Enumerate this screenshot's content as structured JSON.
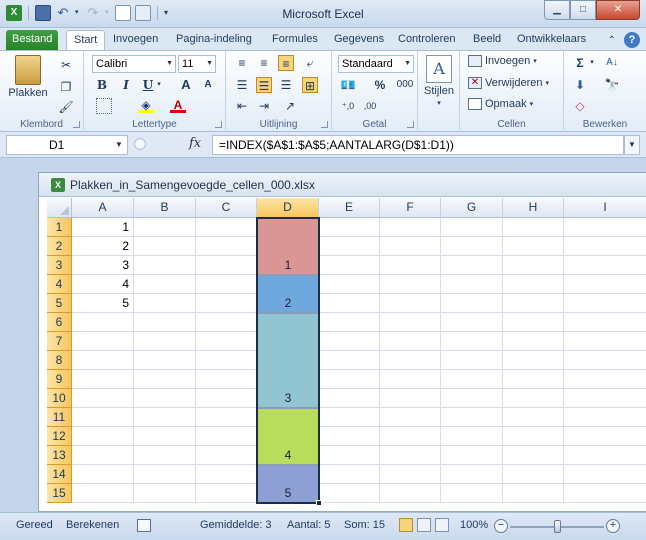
{
  "app": {
    "title": "Microsoft Excel"
  },
  "tabs": [
    {
      "label": "Bestand"
    },
    {
      "label": "Start"
    },
    {
      "label": "Invoegen"
    },
    {
      "label": "Pagina-indeling"
    },
    {
      "label": "Formules"
    },
    {
      "label": "Gegevens"
    },
    {
      "label": "Controleren"
    },
    {
      "label": "Beeld"
    },
    {
      "label": "Ontwikkelaars"
    }
  ],
  "ribbon": {
    "groups": {
      "klembord": "Klembord",
      "lettertype": "Lettertype",
      "uitlijning": "Uitlijning",
      "getal": "Getal",
      "cellen": "Cellen",
      "bewerken": "Bewerken"
    },
    "paste_label": "Plakken",
    "font_name": "Calibri",
    "font_size": "11",
    "number_format": "Standaard",
    "styles_label": "Stijlen",
    "insert_label": "Invoegen",
    "delete_label": "Verwijderen",
    "format_label": "Opmaak",
    "percent": "%",
    "thousands": "000",
    "bold": "B",
    "italic": "I",
    "underline": "U",
    "grow_font": "A",
    "shrink_font": "A"
  },
  "formula_bar": {
    "name_box": "D1",
    "fx": "fx",
    "formula": "=INDEX($A$1:$A$5;AANTALARG(D$1:D1))"
  },
  "workbook": {
    "filename": "Plakken_in_Samengevoegde_cellen_000.xlsx",
    "columns": [
      "A",
      "B",
      "C",
      "D",
      "E",
      "F",
      "G",
      "H",
      "I"
    ],
    "rows": [
      "1",
      "2",
      "3",
      "4",
      "5",
      "6",
      "7",
      "8",
      "9",
      "10",
      "11",
      "12",
      "13",
      "14",
      "15"
    ],
    "column_a_values": [
      "1",
      "2",
      "3",
      "4",
      "5"
    ],
    "merged_d": [
      {
        "value": "1",
        "color": "#d99694"
      },
      {
        "value": "2",
        "color": "#6fa8dc"
      },
      {
        "value": "3",
        "color": "#92c5d2"
      },
      {
        "value": "4",
        "color": "#b8dc5c"
      },
      {
        "value": "5",
        "color": "#8e9fd4"
      }
    ]
  },
  "status_bar": {
    "ready": "Gereed",
    "calculate": "Berekenen",
    "average": "Gemiddelde: 3",
    "count": "Aantal: 5",
    "sum": "Som: 15",
    "zoom": "100%",
    "zoom_minus": "−",
    "zoom_plus": "+"
  },
  "colors": {
    "file_tab": "#2a872d",
    "selection_header": "#f6c65d",
    "selection_border": "#1f2d43"
  }
}
